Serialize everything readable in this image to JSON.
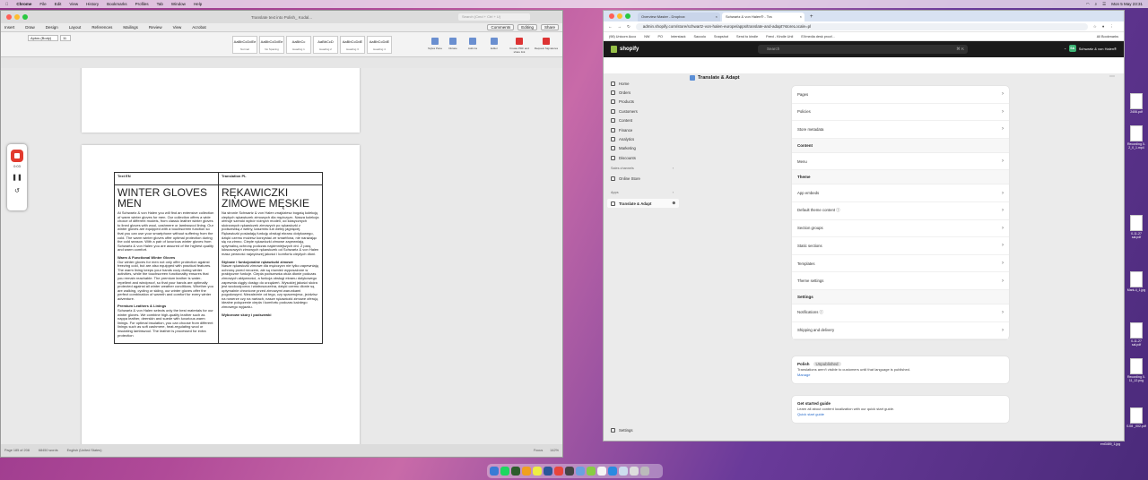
{
  "menubar": {
    "app": "Chrome",
    "items": [
      "File",
      "Edit",
      "View",
      "History",
      "Bookmarks",
      "Profiles",
      "Tab",
      "Window",
      "Help"
    ],
    "datetime": "Mon 5 May 23:31"
  },
  "desktop_files": [
    "2406.pdf",
    "Recording\n0-2_0_1.mp4",
    "0-11-27\nsal.pdf",
    "Mark-4_1.jpg",
    "0-11-27\nsal.pdf",
    "Recording\n0-11_12.png",
    "0-08\n_002.pdf",
    "ent3489_1.jpg"
  ],
  "word": {
    "window_title": "Translate text into Polish_ Kodal...",
    "search_placeholder": "Search (Cmd + Ctrl + U)",
    "tabs": [
      "Insert",
      "Draw",
      "Design",
      "Layout",
      "References",
      "Mailings",
      "Review",
      "View",
      "Acrobat"
    ],
    "tab_buttons": [
      "Comments",
      "Editing",
      "Share"
    ],
    "font": "Aptos (Body)",
    "size": "11",
    "styles": [
      {
        "sample": "AaBbCcDdEe",
        "name": "Normal"
      },
      {
        "sample": "AaBbCcDdEe",
        "name": "No Spacing"
      },
      {
        "sample": "AaBbCc",
        "name": "Heading 1"
      },
      {
        "sample": "AaBbCcD",
        "name": "Heading 2"
      },
      {
        "sample": "AaBbCcDdE",
        "name": "Heading 3"
      },
      {
        "sample": "AaBbCcDdE",
        "name": "Heading 4"
      }
    ],
    "ribbon_buttons": [
      "Styles Pane",
      "Dictate",
      "Add-ins",
      "Editor",
      "Create PDF and share link",
      "Request Signatures"
    ],
    "table": {
      "col_en": "Text EN",
      "col_pl": "Translation PL",
      "title_en": "WINTER GLOVES MEN",
      "title_pl": "RĘKAWICZKI ZIMOWE MĘSKIE",
      "en_p1": "At Schwartz & von Halen you will find an extensive collection of warm winter gloves for men. Our collection offers a wide choice of different models, from classic leather winter gloves to lined gloves with wool, cashmere or lambswool lining. Our winter gloves are equipped with a touchscreen function so that you can use your smartphone without suffering from the cold. The warm winter gloves offer optimal protection during the cold season. With a pair of luxurious winter gloves from Schwartz & von Halen you are assured of the highest quality and warm comfort.",
      "en_h2": "Warm & Functional Winter Gloves",
      "en_p2": "Our winter gloves for men not only offer protection against freezing cold, but are also equipped with practical features. The warm lining keeps your hands cozy during winter activities, while the touchscreen functionality ensures that you remain reachable. The premium leather is water-repellent and windproof, so that your hands are optimally protected against all winter weather conditions. Whether you are walking, cycling or skiing, our winter gloves offer the perfect combination of warmth and comfort for every winter adventure.",
      "en_h3": "Premium Leathers & Linings",
      "en_p3": "Schwartz & von Halen selects only the best materials for our winter gloves. We combine high-quality leather such as nappa leather, deerskin and suede with luxurious warm linings. For optimal insulation, you can choose from different linings such as soft cashmere, heat-regulating wool or insulating lambswool. The leather is processed for extra protection",
      "pl_p1": "Na stronie Schwartz & von Halen znajdziesz bogatą kolekcję ciepłych rękawiczek zimowych dla mężczyzn. Nasza kolekcja oferuje szeroki wybór różnych modeli, od klasycznych skórzanych rękawiczek zimowych po rękawiczki z podszewką z wełny, kaszmiru lub wełny jagnięcej. Rękawiczki posiadają funkcję obsługi ekranu dotykowego, dzięki czemu możesz korzystać ze smartfona, nie narażając się na zimno. Ciepłe rękawiczki zimowe zapewniają optymalną ochronę podczas najzimniejszych dni. Z parą luksusowych zimowych rękawiczek od Schwartz & von Halen masz pewność najwyższej jakości i komfortu ciepłych dłoni.",
      "pl_h2": "Stylowe i funkcjonalne rękawiczki zimowe",
      "pl_p2": "Nasze rękawiczki zimowe dla mężczyzn nie tylko zapewniają ochronę przed mrozem, ale są również wyposażone w praktyczne funkcje. Ciepła podszewka otula dłonie podczas zimowych aktywności, a funkcja obsługi ekranu dotykowego zapewnia ciągły dostęp do urządzeń. Wysokiej jakości skóra jest wodoodporna i wiatroszczelna, dzięki czemu dłonie są optymalnie chronione przed zimowymi warunkami pogodowymi. Niezależnie od tego, czy spacerujesz, jeździsz na rowerze czy na nartach, nasze rękawiczki zimowe oferują idealne połączenie ciepła i komfortu podczas każdego zimowego wyjazdu.",
      "pl_tail": "Wyborowe skóry i podszewki"
    },
    "status": {
      "page": "Page 185 of 208",
      "words": "68450 words",
      "lang": "English (United States)",
      "focus": "Focus",
      "zoom": "142%"
    }
  },
  "recorder": {
    "time": "0:03"
  },
  "chrome": {
    "tabs": [
      {
        "label": "Overview Master - Dropbox"
      },
      {
        "label": "Schwartz & von Halen® - Tra"
      }
    ],
    "url": "admin.shopify.com/store/schwartz-von-halen-europe/apps/translate-and-adapt?storeLocale=pl",
    "bookmarks": [
      "(98) Unicorn Acco",
      "NW",
      "PO",
      "Interstack",
      "Saccolo",
      "Snapshot",
      "Send to kindle",
      "Feed - Kindle Unli",
      "EXmedia desk proof..."
    ],
    "all_bookmarks": "All Bookmarks"
  },
  "shopify": {
    "logo": "shopify",
    "search": "Search",
    "search_kbd": "⌘ K",
    "store": "Schwartz & von Halen®",
    "store_initials": "S&",
    "app_title": "Translate & Adapt",
    "nav": [
      "Home",
      "Orders",
      "Products",
      "Customers",
      "Content",
      "Finance",
      "Analytics",
      "Marketing",
      "Discounts"
    ],
    "sales_channels": "Sales channels",
    "online_store": "Online Store",
    "apps": "Apps",
    "translate_app": "Translate & Adapt",
    "settings": "Settings",
    "rows_top": [
      "Pages",
      "Policies",
      "Store metadata"
    ],
    "content_head": "Content",
    "content_rows": [
      "Menu"
    ],
    "theme_head": "Theme",
    "theme_rows": [
      "App embeds",
      "Default theme content",
      "Section groups",
      "Static sections",
      "Templates",
      "Theme settings"
    ],
    "settings_head": "Settings",
    "settings_rows": [
      "Notifications",
      "Shipping and delivery"
    ],
    "polish": {
      "title": "Polish",
      "badge": "Unpublished",
      "desc": "Translations aren't visible to customers until that language is published.",
      "link": "Manage"
    },
    "guide": {
      "title": "Get started guide",
      "desc": "Learn all about content localization with our quick start guide.",
      "link": "Quick start guide"
    }
  },
  "colors": {
    "shopify_green": "#95bf47",
    "record_red": "#e23a2e",
    "link_blue": "#2c6ecb"
  }
}
